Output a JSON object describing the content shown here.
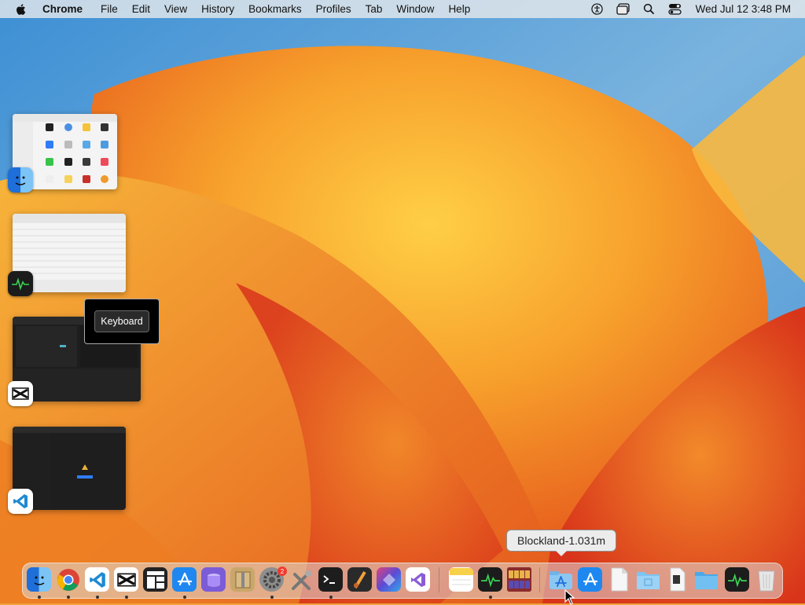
{
  "menubar": {
    "app_name": "Chrome",
    "items": [
      "File",
      "Edit",
      "View",
      "History",
      "Bookmarks",
      "Profiles",
      "Tab",
      "Window",
      "Help"
    ],
    "clock": "Wed Jul 12  3:48 PM",
    "status_icons": [
      "accessibility-icon",
      "window-icon",
      "search-icon",
      "control-center-icon"
    ]
  },
  "stage_manager": {
    "windows": [
      {
        "app": "Finder",
        "icon": "finder-icon"
      },
      {
        "app": "Activity Monitor",
        "icon": "activity-monitor-icon"
      },
      {
        "app": "CapCut",
        "icon": "capcut-icon"
      },
      {
        "app": "Visual Studio Code",
        "icon": "vscode-icon"
      }
    ]
  },
  "keyboard_popover": {
    "label": "Keyboard"
  },
  "dock_tooltip": {
    "label": "Blockland-1.031m"
  },
  "dock": {
    "settings_badge": "2",
    "apps": [
      "finder-icon",
      "chrome-icon",
      "vscode-icon",
      "capcut-icon",
      "mosaic-icon",
      "app-store-icon",
      "tableplus-icon",
      "archive-utility-icon",
      "system-settings-icon",
      "xcode-tools-icon",
      "terminal-icon",
      "instruments-icon",
      "affinity-icon",
      "visual-studio-icon",
      "notes-icon",
      "activity-monitor-icon",
      "photo-booth-icon",
      "blockland-installer-icon",
      "app-store-icon-2",
      "document-icon",
      "folder-icon-1",
      "script-icon",
      "folder-icon-2",
      "activity-monitor-icon-2",
      "trash-icon"
    ]
  },
  "colors": {
    "wallpaper_orange": "#f39a2b",
    "wallpaper_red": "#e0401a",
    "wallpaper_blue": "#3d8fd4",
    "accent_blue": "#2f7df6"
  }
}
